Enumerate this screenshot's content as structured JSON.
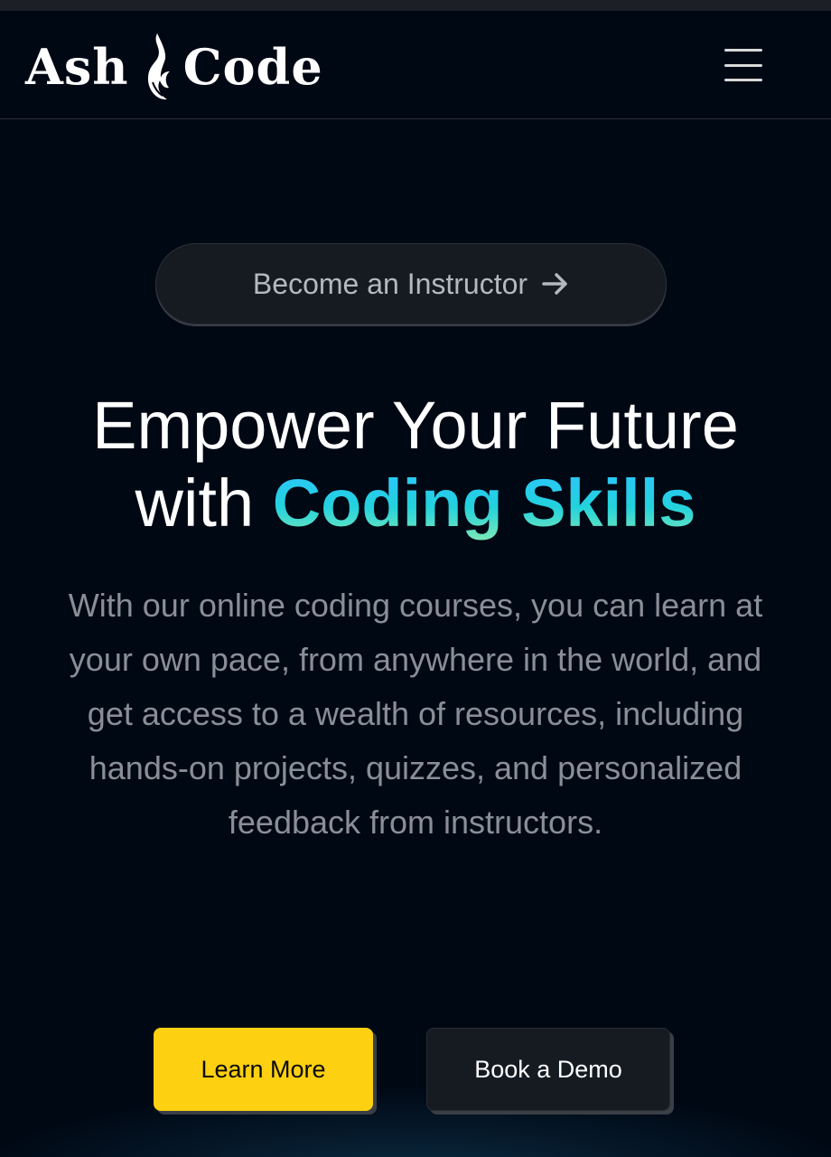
{
  "header": {
    "logo_left": "Ash",
    "logo_right": "Code",
    "logo_icon": "flame-feather-icon",
    "menu_icon": "hamburger-menu-icon"
  },
  "hero": {
    "instructor_link": "Become an Instructor",
    "instructor_link_icon": "arrow-right-icon",
    "headline_line1": "Empower Your Future",
    "headline_prefix": "with",
    "headline_accent": "Coding Skills",
    "description": "With our online coding courses, you can learn at your own pace, from anywhere in the world, and get access to a wealth of resources, including hands-on projects, quizzes, and personalized feedback from instructors."
  },
  "actions": {
    "learn_more": "Learn More",
    "book_demo": "Book a Demo"
  },
  "colors": {
    "background": "#000814",
    "accent_gradient_start": "#2ec4ff",
    "accent_gradient_end": "#7de8b8",
    "primary_button": "#fdd012",
    "secondary_button": "#161b22"
  }
}
